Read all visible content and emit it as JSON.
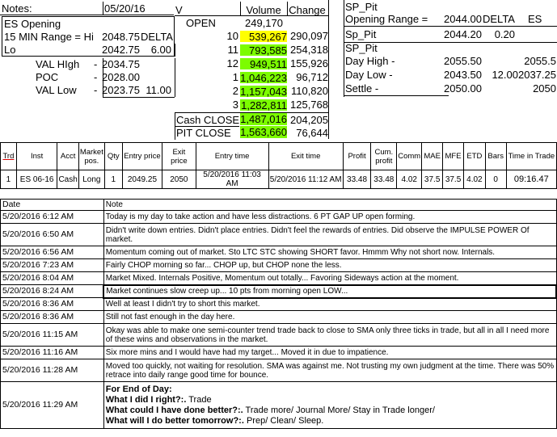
{
  "sheet": {
    "notes_label": "Notes:",
    "date": "05/20/16",
    "col_v": "V",
    "col_volume": "Volume",
    "col_change": "Change",
    "open_label": "OPEN",
    "open_value": "249,170",
    "es_opening": "ES Opening",
    "min15_range": "15 MIN Range = Hi",
    "hi_value": "2048.75",
    "delta_label": "DELTA",
    "lo_label": "Lo",
    "lo_value": "2042.75",
    "lo_delta": "6.00",
    "val_high_label": "VAL HIgh",
    "val_high_dash": "-",
    "val_high_value": "2034.75",
    "poc_label": "POC",
    "poc_dash": "-",
    "poc_value": "2028.00",
    "val_low_label": "VAL Low",
    "val_low_dash": "-",
    "val_low_value": "2023.75",
    "val_low_delta": "11.00",
    "volume_rows": [
      {
        "v": "10",
        "volume": "539,267",
        "change": "290,097",
        "color": "#ffff00"
      },
      {
        "v": "11",
        "volume": "793,585",
        "change": "254,318",
        "color": "#7cfc00"
      },
      {
        "v": "12",
        "volume": "949,511",
        "change": "155,926",
        "color": "#7cfc00"
      },
      {
        "v": "1",
        "volume": "1,046,223",
        "change": "96,712",
        "color": "#7cfc00"
      },
      {
        "v": "2",
        "volume": "1,157,043",
        "change": "110,820",
        "color": "#7cfc00"
      },
      {
        "v": "3",
        "volume": "1,282,811",
        "change": "125,768",
        "color": "#7cfc00"
      }
    ],
    "cash_close_label": "Cash CLOSE",
    "cash_close_volume": "1,487,016",
    "cash_close_change": "204,205",
    "pit_close_label": "PIT CLOSE",
    "pit_close_volume": "1,563,660",
    "pit_close_change": "76,644",
    "sp_pit": "SP_Pit",
    "opening_range_label": "Opening Range =",
    "opening_range_value": "2044.00",
    "or_delta_label": "DELTA",
    "or_es": "ES",
    "sp_pit_2": "Sp_Pit",
    "sp_pit_2_value": "2044.20",
    "sp_pit_2_delta": "0.20",
    "sp_pit_3": "SP_Pit",
    "day_high_label": "Day High -",
    "day_high_value": "2055.50",
    "day_high_es": "2055.5",
    "day_low_label": "Day Low -",
    "day_low_value": "2043.50",
    "day_low_delta": "12.00",
    "day_low_es": "2037.25",
    "settle_label": "Settle -",
    "settle_value": "2050.00",
    "settle_es": "2050"
  },
  "trade": {
    "headers": [
      "Trd",
      "Inst",
      "Acct",
      "Market pos.",
      "Qty",
      "Entry price",
      "Exit price",
      "Entry time",
      "Exit time",
      "Profit",
      "Cum. profit",
      "Comm",
      "MAE",
      "MFE",
      "ETD",
      "Bars",
      "Time in Trade"
    ],
    "row": [
      "1",
      "ES 06-16",
      "Cash",
      "Long",
      "1",
      "2049.25",
      "2050",
      "5/20/2016 11:03 AM",
      "5/20/2016 11:12 AM",
      "33.48",
      "33.48",
      "4.02",
      "37.5",
      "37.5",
      "4.02",
      "0",
      "09:16.47"
    ]
  },
  "log": {
    "date_header": "Date",
    "note_header": "Note",
    "entries": [
      {
        "date": "5/20/2016 6:12 AM",
        "note": "Today is my day to take action and have less distractions.  6 PT GAP UP open forming."
      },
      {
        "date": "5/20/2016 6:50 AM",
        "note": "Didn't write down entries.  Didn't place entries.  Didn't feel the rewards of entries.  Did observe the IMPULSE POWER Of market."
      },
      {
        "date": "5/20/2016 6:56 AM",
        "note": "Momentum coming out of market.  Sto LTC STC showing SHORT favor.  Hmmm Why not short now.  Internals."
      },
      {
        "date": "5/20/2016 7:23 AM",
        "note": "Fairly CHOP morning so far... CHOP up, but CHOP none the less."
      },
      {
        "date": "5/20/2016 8:04 AM",
        "note": "Market Mixed.  Internals Positive, Momentum out totally... Favoring Sideways action at the moment."
      },
      {
        "date": "5/20/2016 8:24 AM",
        "note": "Market continues slow creep up... 10 pts from morning open LOW..."
      },
      {
        "date": "5/20/2016 8:36 AM",
        "note": "Well at least I didn't try to short this market."
      },
      {
        "date": "5/20/2016 8:36 AM",
        "note": "Still not fast enough in the day here."
      },
      {
        "date": "5/20/2016 11:15 AM",
        "note": "Okay was able to make one semi-counter trend trade back to close to SMA only three ticks in trade, but all in all I need more of these wins and observations in the market."
      },
      {
        "date": "5/20/2016 11:16 AM",
        "note": "Six more mins and I would have had my target... Moved it in due to impatience."
      },
      {
        "date": "5/20/2016 11:28 AM",
        "note": "Moved too quickly, not waiting for resolution.  SMA was against me.  Not trusting my own judgment at the time.  There was 50% retrace into daily range good time for bounce."
      }
    ],
    "final": {
      "date": "5/20/2016 11:29 AM",
      "l1_bold": "For End of Day:",
      "l2_bold": "What I did I right?:.",
      "l2_text": "  Trade",
      "l3_bold": "What could I have done better?:.",
      "l3_text": "  Trade more/ Journal More/ Stay in Trade longer/",
      "l4_bold": "What will I do better tomorrow?:.",
      "l4_text": "  Prep/ Clean/ Sleep."
    }
  }
}
